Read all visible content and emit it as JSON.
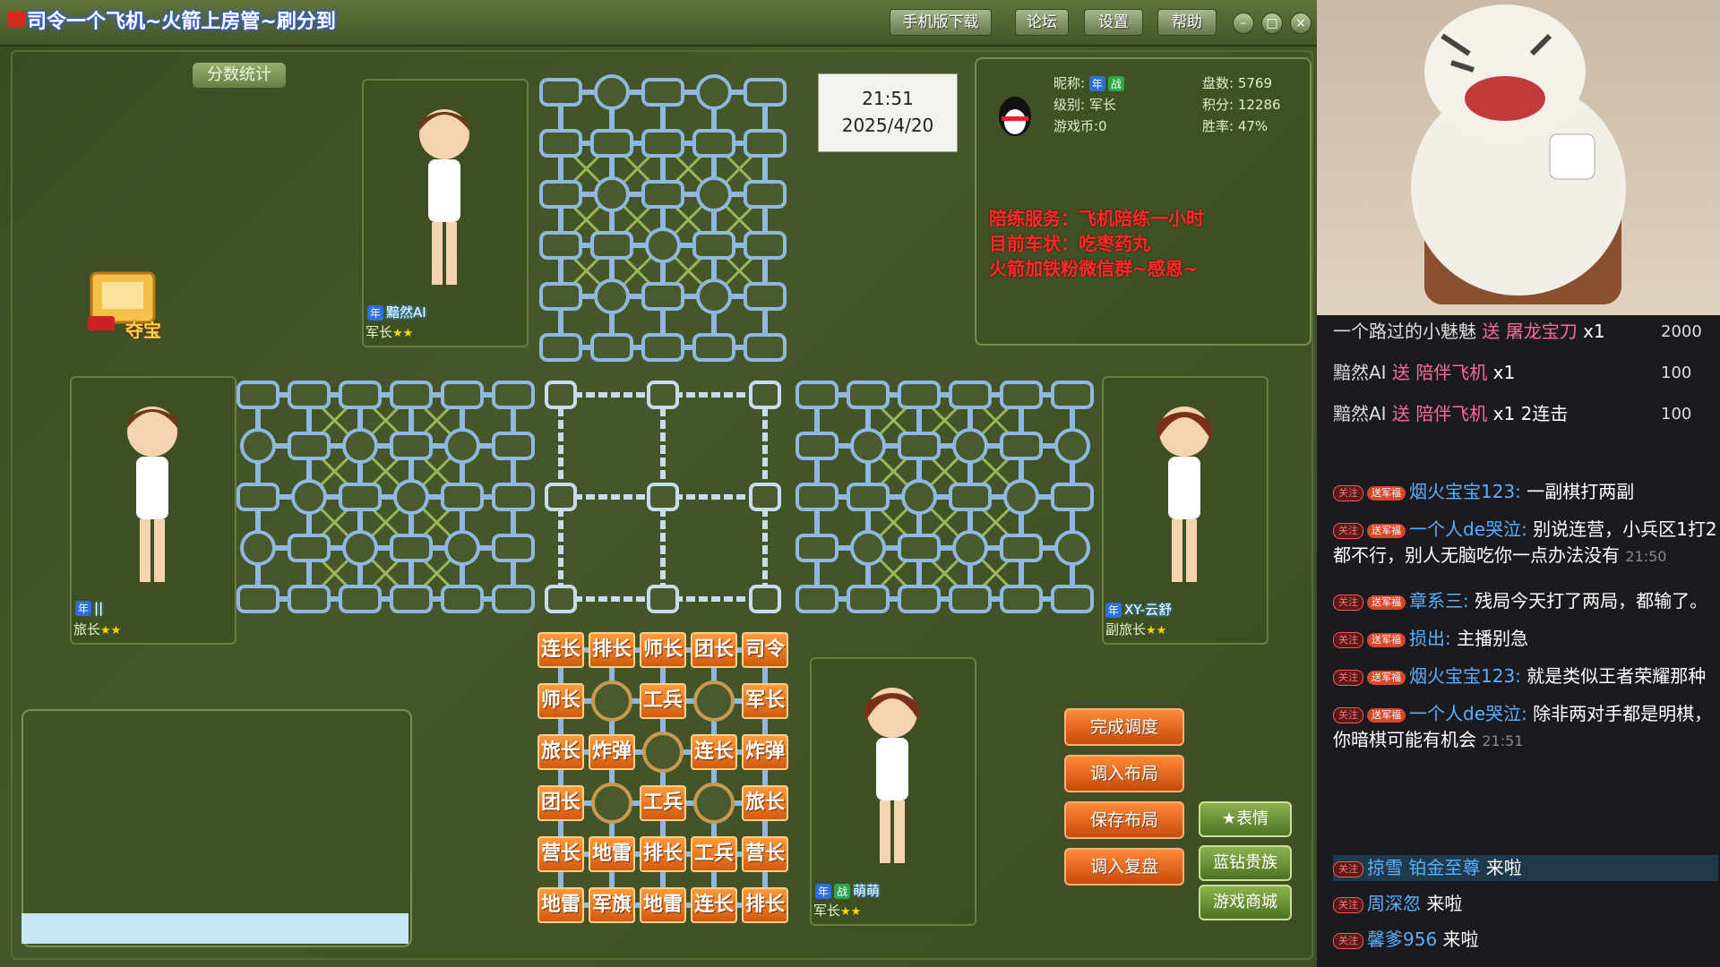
{
  "window": {
    "title": "司令一个飞机~火箭上房管~刷分到",
    "buttons": [
      "手机版下载",
      "论坛",
      "设置",
      "帮助"
    ],
    "controls": [
      "–",
      "□",
      "×"
    ]
  },
  "score_stats_label": "分数统计",
  "clock": {
    "time": "21:51",
    "date": "2025/4/20"
  },
  "profile": {
    "nickname_label": "昵称:",
    "level_label": "级别: 军长",
    "coins_label": "游戏币:0",
    "games_label": "盘数: 5769",
    "points_label": "积分: 12286",
    "winrate_label": "胜率: 47%"
  },
  "notice": [
    "陪练服务：飞机陪练一小时",
    "目前车状：吃枣药丸",
    "火箭加铁粉微信群~感恩~"
  ],
  "treasure_label": "夺宝",
  "players": {
    "top": {
      "name": "黯然AI",
      "rank": "军长",
      "tag": "年"
    },
    "left": {
      "name": "||",
      "rank": "旅长",
      "tag": "年"
    },
    "right": {
      "name": "XY-云舒",
      "rank": "副旅长",
      "tag": "年"
    },
    "bottom": {
      "name": "萌萌",
      "rank": "军长",
      "tag": "年",
      "tag2": "战"
    }
  },
  "pieces": [
    [
      "连长",
      "排长",
      "师长",
      "团长",
      "司令"
    ],
    [
      "师长",
      "",
      "工兵",
      "",
      "军长"
    ],
    [
      "旅长",
      "炸弹",
      "",
      "连长",
      "炸弹"
    ],
    [
      "团长",
      "",
      "工兵",
      "",
      "旅长"
    ],
    [
      "营长",
      "地雷",
      "排长",
      "工兵",
      "营长"
    ],
    [
      "地雷",
      "军旗",
      "地雷",
      "连长",
      "排长"
    ]
  ],
  "actions": [
    "完成调度",
    "调入布局",
    "保存布局",
    "调入复盘"
  ],
  "green_buttons": [
    "表情",
    "蓝钻贵族",
    "游戏商城"
  ],
  "chat": {
    "gifts": [
      {
        "user": "一个路过的小魅魅",
        "verb": "送",
        "gift": "屠龙宝刀",
        "count": "x1",
        "coins": "2000"
      },
      {
        "user": "黯然AI",
        "verb": "送",
        "gift": "陪伴飞机",
        "count": "x1",
        "coins": "100"
      },
      {
        "user": "黯然AI",
        "verb": "送",
        "gift": "陪伴飞机",
        "count": "x1 2连击",
        "coins": "100"
      }
    ],
    "messages": [
      {
        "user": "烟火宝宝123:",
        "text": "一副棋打两副",
        "time": ""
      },
      {
        "user": "一个人de哭泣:",
        "text": "别说连营，小兵区1打2都不行，别人无脑吃你一点办法没有",
        "time": "21:50"
      },
      {
        "user": "章系三:",
        "text": "残局今天打了两局，都输了。",
        "time": ""
      },
      {
        "user": "损出:",
        "text": "主播别急",
        "time": ""
      },
      {
        "user": "烟火宝宝123:",
        "text": "就是类似王者荣耀那种",
        "time": ""
      },
      {
        "user": "一个人de哭泣:",
        "text": "除非两对手都是明棋，你暗棋可能有机会",
        "time": "21:51"
      }
    ],
    "joins": [
      {
        "user": "掠雪 铂金至尊",
        "text": "来啦"
      },
      {
        "user": "周深忽",
        "text": "来啦"
      },
      {
        "user": "馨爹956",
        "text": "来啦"
      }
    ],
    "badge_follow": "关注",
    "badge_fan": "送军福"
  },
  "colors": {
    "piece": "#e4741e",
    "board_line": "#8fb8e0",
    "notice": "#ff2a2a",
    "username": "#5ab0ff"
  }
}
